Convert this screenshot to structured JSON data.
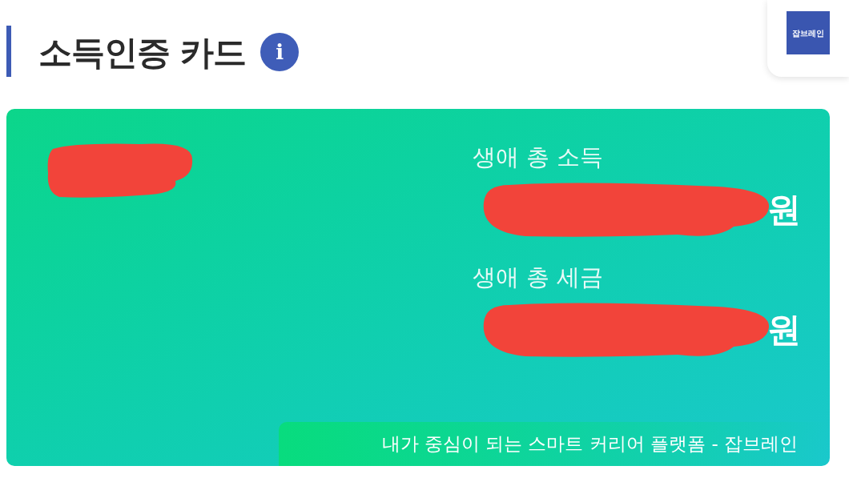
{
  "header": {
    "title": "소득인증 카드",
    "info_icon": "i"
  },
  "logo": {
    "text": "잡브레인"
  },
  "card": {
    "fields": [
      {
        "label": "생애 총 소득",
        "amount": "원"
      },
      {
        "label": "생애 총 세금",
        "amount": "원"
      }
    ],
    "footer": "내가 중심이 되는 스마트 커리어 플랫폼 - 잡브레인"
  }
}
